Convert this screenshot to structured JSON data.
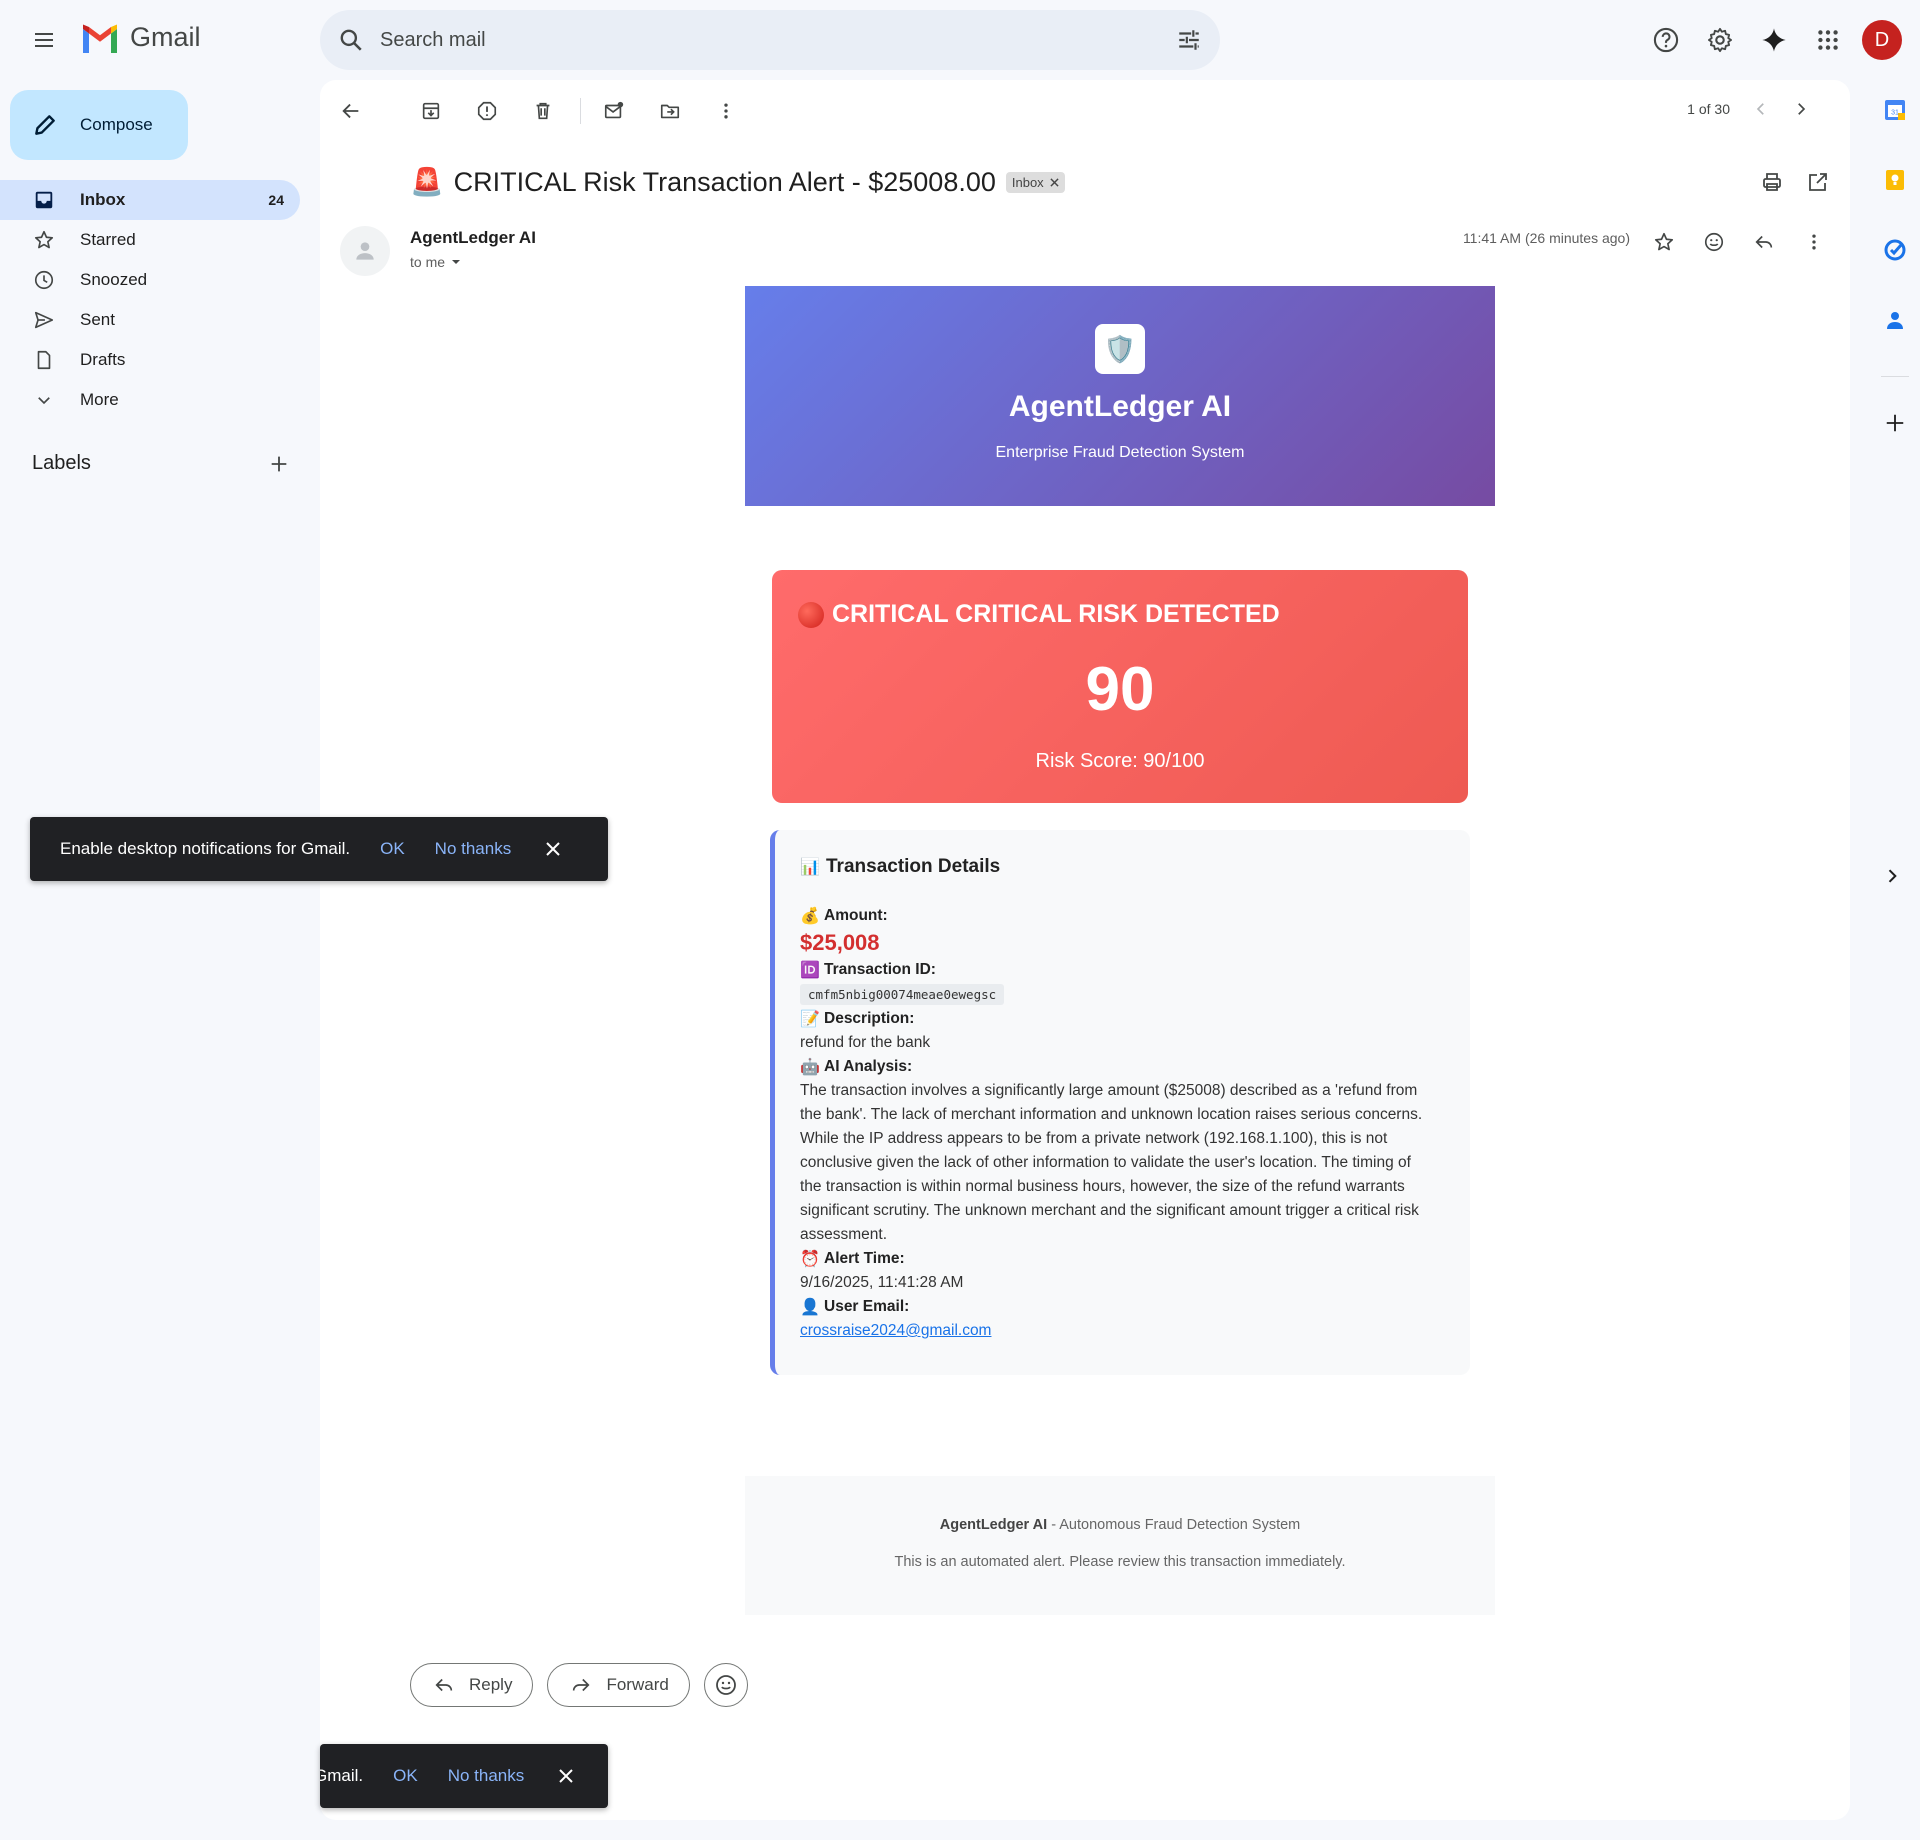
{
  "app": {
    "name": "Gmail"
  },
  "search": {
    "placeholder": "Search mail"
  },
  "user": {
    "avatar_letter": "D",
    "avatar_color": "#c5221f"
  },
  "compose": {
    "label": "Compose"
  },
  "nav": {
    "items": [
      {
        "label": "Inbox",
        "count": "24",
        "icon": "inbox-icon",
        "active": true
      },
      {
        "label": "Starred",
        "icon": "star-icon"
      },
      {
        "label": "Snoozed",
        "icon": "clock-icon"
      },
      {
        "label": "Sent",
        "icon": "send-icon"
      },
      {
        "label": "Drafts",
        "icon": "draft-icon"
      },
      {
        "label": "More",
        "icon": "chevron-down-icon"
      }
    ],
    "labels_heading": "Labels"
  },
  "pager": {
    "text": "1 of 30"
  },
  "message": {
    "subject_emoji": "🚨",
    "subject": "CRITICAL Risk Transaction Alert - $25008.00",
    "label_chip": "Inbox",
    "sender": "AgentLedger AI",
    "recipient": "to me",
    "time": "11:41 AM (26 minutes ago)"
  },
  "email": {
    "hero": {
      "shield_emoji": "🛡️",
      "title": "AgentLedger AI",
      "subtitle": "Enterprise Fraud Detection System",
      "gradient_start": "#667eea",
      "gradient_end": "#764ba2"
    },
    "risk": {
      "heading": "CRITICAL CRITICAL RISK DETECTED",
      "score": "90",
      "score_label": "Risk Score: 90/100",
      "color": "#ff6b6b"
    },
    "details": {
      "heading_emoji": "📊",
      "heading": "Transaction Details",
      "amount_emoji": "💰",
      "amount_label": "Amount:",
      "amount_value": "$25,008",
      "txid_emoji": "🆔",
      "txid_label": "Transaction ID:",
      "txid_value": "cmfm5nbig00074meae0ewegsc",
      "desc_emoji": "📝",
      "desc_label": "Description:",
      "desc_value": "refund for the bank",
      "ai_emoji": "🤖",
      "ai_label": "AI Analysis:",
      "ai_value": "The transaction involves a significantly large amount ($25008) described as a 'refund from the bank'. The lack of merchant information and unknown location raises serious concerns. While the IP address appears to be from a private network (192.168.1.100), this is not conclusive given the lack of other information to validate the user's location. The timing of the transaction is within normal business hours, however, the size of the refund warrants significant scrutiny. The unknown merchant and the significant amount trigger a critical risk assessment.",
      "time_emoji": "⏰",
      "time_label": "Alert Time:",
      "time_value": "9/16/2025, 11:41:28 AM",
      "user_emoji": "👤",
      "user_label": "User Email:",
      "user_value": "crossraise2024@gmail.com"
    },
    "footer": {
      "brand": "AgentLedger AI",
      "tagline": " - Autonomous Fraud Detection System",
      "note": "This is an automated alert. Please review this transaction immediately."
    }
  },
  "actions": {
    "reply": "Reply",
    "forward": "Forward"
  },
  "toast": {
    "message": "Enable desktop notifications for Gmail.",
    "message_partial": "Gmail.",
    "ok": "OK",
    "no_thanks": "No thanks"
  }
}
